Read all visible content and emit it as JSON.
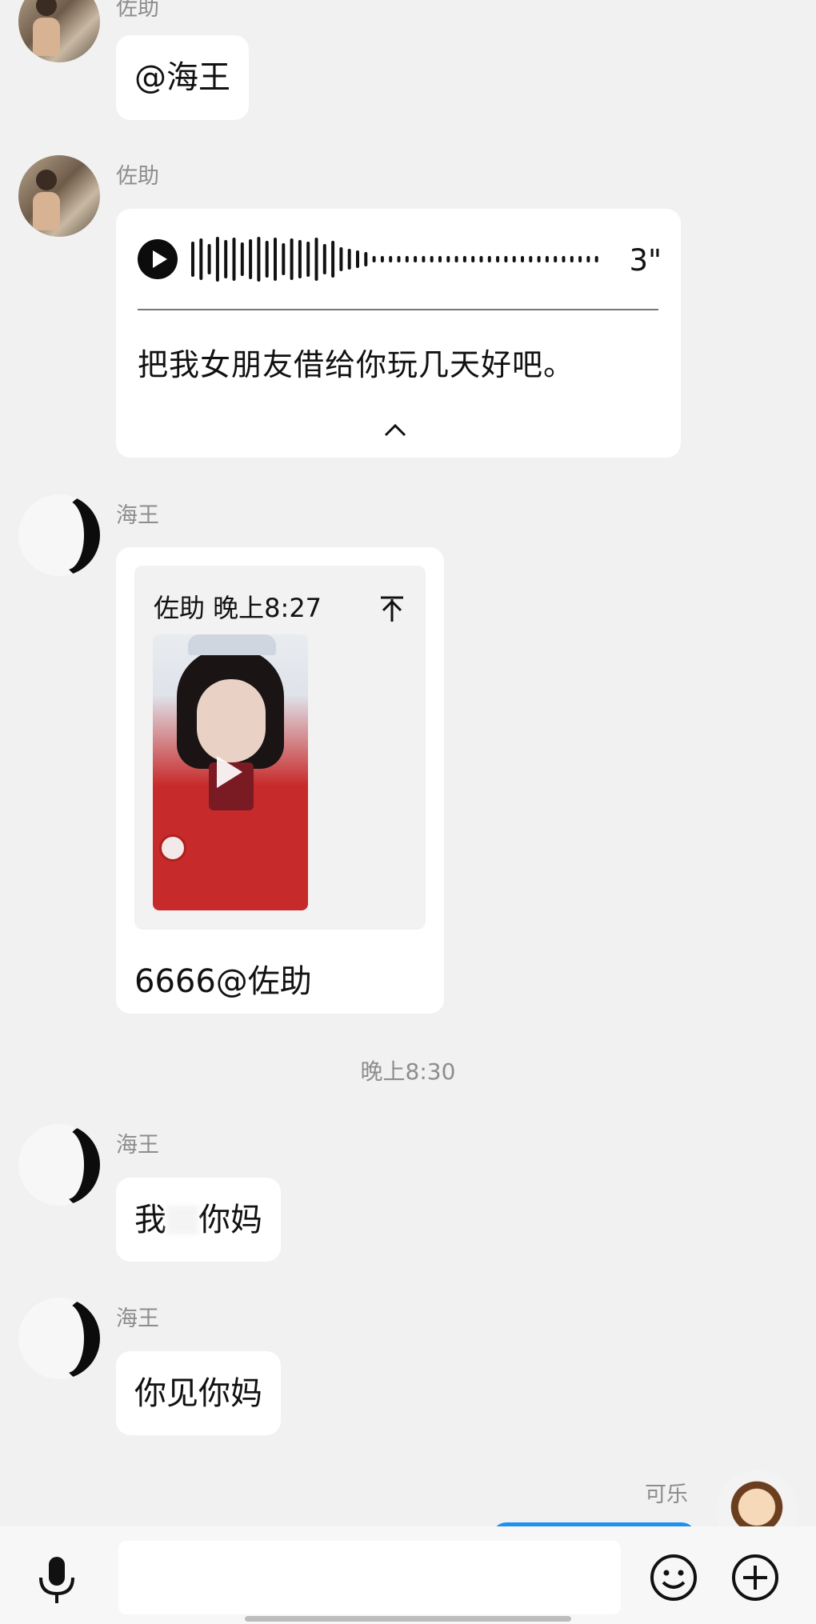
{
  "messages": {
    "m0": {
      "sender": "佐助",
      "text": "@海王"
    },
    "m1": {
      "sender": "佐助",
      "duration": "3\"",
      "transcript": "把我女朋友借给你玩几天好吧。"
    },
    "m2": {
      "sender": "海王",
      "quote_header": "佐助 晚上8:27",
      "text": "6666@佐助"
    },
    "time_divider": "晚上8:30",
    "m3": {
      "sender": "海王",
      "text_before": "我",
      "text_after": "你妈"
    },
    "m4": {
      "sender": "海王",
      "text": "你见你妈"
    },
    "m5": {
      "sender": "可乐"
    }
  },
  "icons": {
    "play": "play-icon",
    "chevron": "chevron-up-icon",
    "pin": "pin-top-icon",
    "mic": "microphone-icon",
    "emoji": "smiley-icon",
    "plus": "plus-circle-icon"
  },
  "colors": {
    "background": "#f1f1f1",
    "bubble": "#ffffff",
    "self_bubble": "#1e90ee",
    "meta_text": "#8d8d8d"
  }
}
